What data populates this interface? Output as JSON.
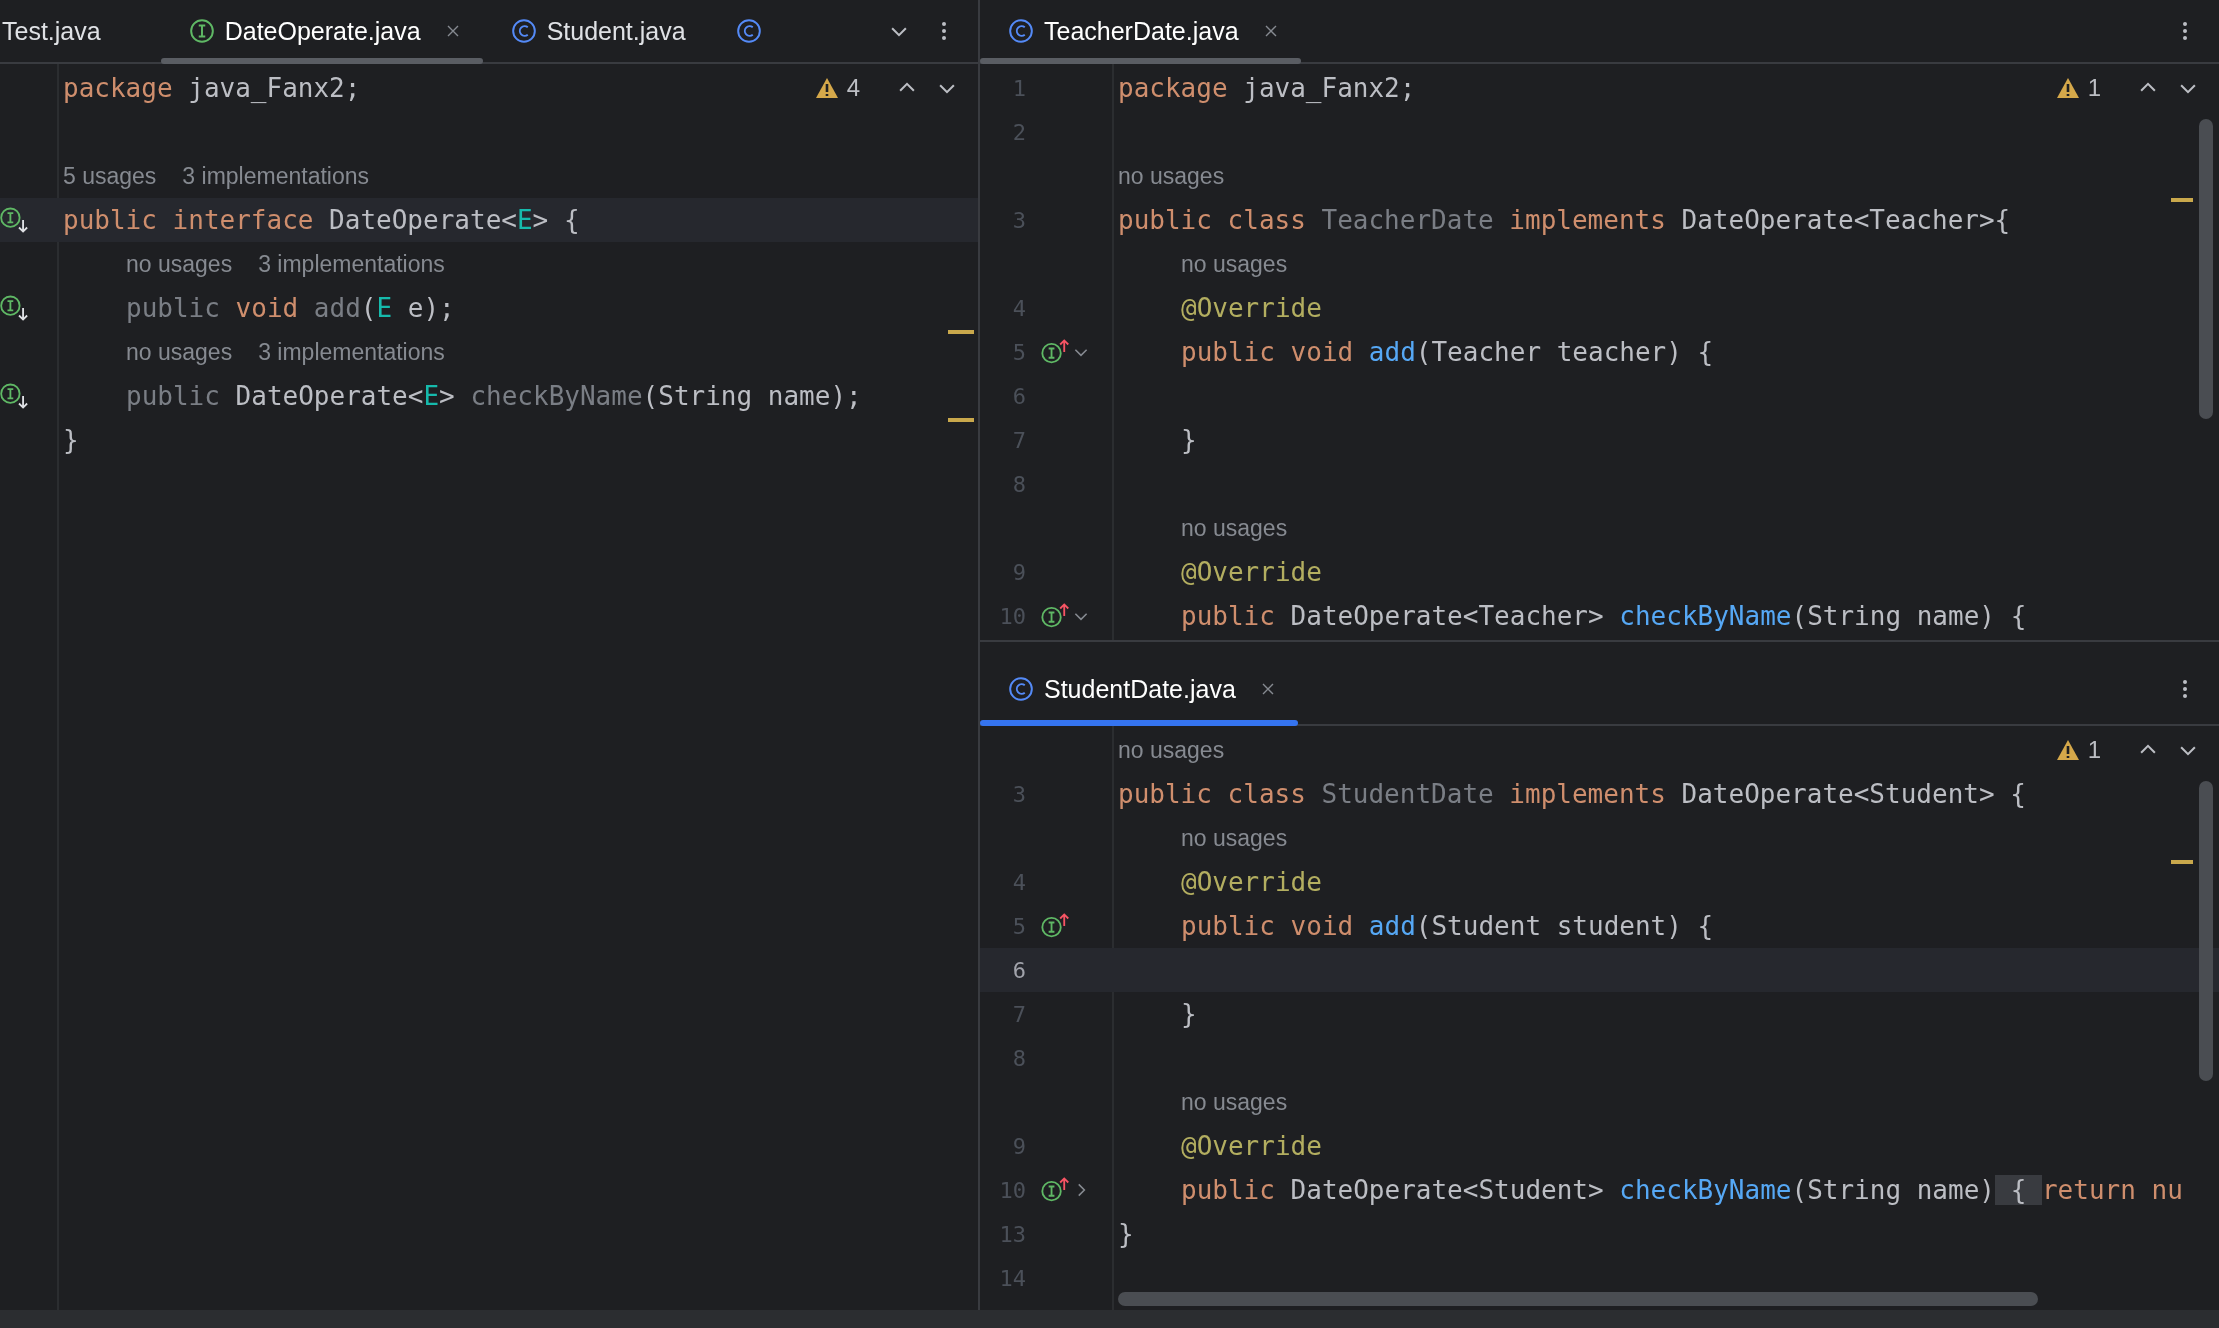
{
  "panes": [
    {
      "focused": false,
      "warning_count": "4",
      "tab_list_button": true,
      "tabs": [
        {
          "label": "Test.java",
          "selected": false
        },
        {
          "label": "DateOperate.java",
          "kind": "interface",
          "selected": true,
          "closable": true
        },
        {
          "label": "Student.java",
          "kind": "class",
          "selected": false
        },
        {
          "kind": "class",
          "selected": false
        }
      ],
      "lines": [
        {
          "kind": "code",
          "current": false,
          "tokens": [
            {
              "t": "package",
              "kind": "kw"
            },
            {
              "t": " java_Fanx2;",
              "kind": "plain"
            }
          ]
        },
        {
          "kind": "blank",
          "current": false
        },
        {
          "kind": "hint",
          "current": false,
          "texts": [
            "5 usages",
            "3 implementations"
          ]
        },
        {
          "kind": "code",
          "current": true,
          "gutter_icon": {
            "kind": "implemented"
          },
          "tokens": [
            {
              "t": "public interface",
              "kind": "kw"
            },
            {
              "t": " DateOperate<",
              "kind": "plain"
            },
            {
              "t": "E",
              "kind": "generic"
            },
            {
              "t": "> {",
              "kind": "plain"
            }
          ]
        },
        {
          "kind": "hint",
          "current": false,
          "indented": true,
          "texts": [
            "no usages",
            "3 implementations"
          ]
        },
        {
          "kind": "code",
          "current": false,
          "indented": true,
          "marked": true,
          "gutter_icon": {
            "kind": "implemented"
          },
          "tokens": [
            {
              "t": "public",
              "kind": "dim"
            },
            {
              "t": " void",
              "kind": "kw"
            },
            {
              "t": " add",
              "kind": "dim"
            },
            {
              "t": "(",
              "kind": "plain"
            },
            {
              "t": "E",
              "kind": "generic"
            },
            {
              "t": " e);",
              "kind": "plain"
            }
          ]
        },
        {
          "kind": "hint",
          "current": false,
          "indented": true,
          "texts": [
            "no usages",
            "3 implementations"
          ]
        },
        {
          "kind": "code",
          "current": false,
          "indented": true,
          "marked": true,
          "gutter_icon": {
            "kind": "implemented"
          },
          "tokens": [
            {
              "t": "public",
              "kind": "dim"
            },
            {
              "t": " DateOperate<",
              "kind": "plain"
            },
            {
              "t": "E",
              "kind": "generic"
            },
            {
              "t": "> ",
              "kind": "plain"
            },
            {
              "t": "checkByName",
              "kind": "dim"
            },
            {
              "t": "(String name);",
              "kind": "plain"
            }
          ]
        },
        {
          "kind": "code",
          "current": false,
          "tokens": [
            {
              "t": "}",
              "kind": "plain"
            }
          ]
        }
      ]
    },
    {
      "focused": false,
      "warning_count": "1",
      "vertical_scrollbar": true,
      "tabs": [
        {
          "label": "TeacherDate.java",
          "kind": "class",
          "selected": true,
          "closable": true
        }
      ],
      "lines": [
        {
          "kind": "code",
          "number": "1",
          "current": false,
          "tokens": [
            {
              "t": "package",
              "kind": "kw"
            },
            {
              "t": " java_Fanx2;",
              "kind": "plain"
            }
          ]
        },
        {
          "kind": "blank",
          "number": "2",
          "current": false
        },
        {
          "kind": "hint",
          "current": false,
          "marked": true,
          "texts": [
            "no usages"
          ]
        },
        {
          "kind": "code",
          "number": "3",
          "current": false,
          "tokens": [
            {
              "t": "public class",
              "kind": "kw"
            },
            {
              "t": " TeacherDate",
              "kind": "dim"
            },
            {
              "t": " implements",
              "kind": "kw"
            },
            {
              "t": " DateOperate<Teacher>{",
              "kind": "plain"
            }
          ]
        },
        {
          "kind": "hint",
          "current": false,
          "indented": true,
          "texts": [
            "no usages"
          ]
        },
        {
          "kind": "code",
          "number": "4",
          "current": false,
          "indented": true,
          "tokens": [
            {
              "t": "@Override",
              "kind": "annotation"
            }
          ]
        },
        {
          "kind": "code",
          "number": "5",
          "current": false,
          "indented": true,
          "gutter_icon": {
            "kind": "implementing"
          },
          "fold": {
            "kind": "open"
          },
          "tokens": [
            {
              "t": "public void",
              "kind": "kw"
            },
            {
              "t": " add",
              "kind": "method"
            },
            {
              "t": "(Teacher teacher) {",
              "kind": "plain"
            }
          ]
        },
        {
          "kind": "blank",
          "number": "6",
          "current": false
        },
        {
          "kind": "code",
          "number": "7",
          "current": false,
          "indented": true,
          "tokens": [
            {
              "t": "}",
              "kind": "plain"
            }
          ]
        },
        {
          "kind": "blank",
          "number": "8",
          "current": false
        },
        {
          "kind": "hint",
          "current": false,
          "indented": true,
          "texts": [
            "no usages"
          ]
        },
        {
          "kind": "code",
          "number": "9",
          "current": false,
          "indented": true,
          "tokens": [
            {
              "t": "@Override",
              "kind": "annotation"
            }
          ]
        },
        {
          "kind": "code",
          "number": "10",
          "current": false,
          "indented": true,
          "gutter_icon": {
            "kind": "implementing"
          },
          "fold": {
            "kind": "open"
          },
          "tokens": [
            {
              "t": "public",
              "kind": "kw"
            },
            {
              "t": " DateOperate<Teacher> ",
              "kind": "plain"
            },
            {
              "t": "checkByName",
              "kind": "method"
            },
            {
              "t": "(String name) {",
              "kind": "plain"
            }
          ]
        }
      ]
    },
    {
      "focused": true,
      "warning_count": "1",
      "vertical_scrollbar": true,
      "horizontal_scrollbar": true,
      "tabs": [
        {
          "label": "StudentDate.java",
          "kind": "class",
          "selected": true,
          "closable": true
        }
      ],
      "lines": [
        {
          "kind": "hint",
          "current": false,
          "texts": [
            "no usages"
          ]
        },
        {
          "kind": "code",
          "number": "3",
          "current": false,
          "tokens": [
            {
              "t": "public class",
              "kind": "kw"
            },
            {
              "t": " StudentDate",
              "kind": "dim"
            },
            {
              "t": " implements",
              "kind": "kw"
            },
            {
              "t": " DateOperate<Student> {",
              "kind": "plain"
            }
          ]
        },
        {
          "kind": "hint",
          "current": false,
          "indented": true,
          "marked": true,
          "texts": [
            "no usages"
          ]
        },
        {
          "kind": "code",
          "number": "4",
          "current": false,
          "indented": true,
          "tokens": [
            {
              "t": "@Override",
              "kind": "annotation"
            }
          ]
        },
        {
          "kind": "code",
          "number": "5",
          "current": false,
          "indented": true,
          "gutter_icon": {
            "kind": "implementing"
          },
          "tokens": [
            {
              "t": "public void",
              "kind": "kw"
            },
            {
              "t": " add",
              "kind": "method"
            },
            {
              "t": "(Student student) {",
              "kind": "plain"
            }
          ]
        },
        {
          "kind": "blank",
          "number": "6",
          "current": true
        },
        {
          "kind": "code",
          "number": "7",
          "current": false,
          "indented": true,
          "tokens": [
            {
              "t": "}",
              "kind": "plain"
            }
          ]
        },
        {
          "kind": "blank",
          "number": "8",
          "current": false
        },
        {
          "kind": "hint",
          "current": false,
          "indented": true,
          "texts": [
            "no usages"
          ]
        },
        {
          "kind": "code",
          "number": "9",
          "current": false,
          "indented": true,
          "tokens": [
            {
              "t": "@Override",
              "kind": "annotation"
            }
          ]
        },
        {
          "kind": "code",
          "number": "10",
          "current": false,
          "indented": true,
          "gutter_icon": {
            "kind": "implementing"
          },
          "fold": {
            "kind": "closed"
          },
          "tokens": [
            {
              "t": "public",
              "kind": "kw"
            },
            {
              "t": " DateOperate<Student> ",
              "kind": "plain"
            },
            {
              "t": "checkByName",
              "kind": "method"
            },
            {
              "t": "(String name)",
              "kind": "plain"
            },
            {
              "t": " { ",
              "kind": "folded"
            },
            {
              "t": "return nu",
              "kind": "kw"
            }
          ]
        },
        {
          "kind": "code",
          "number": "13",
          "current": false,
          "tokens": [
            {
              "t": "}",
              "kind": "plain"
            }
          ]
        },
        {
          "kind": "blank",
          "number": "14",
          "current": false
        }
      ]
    }
  ]
}
